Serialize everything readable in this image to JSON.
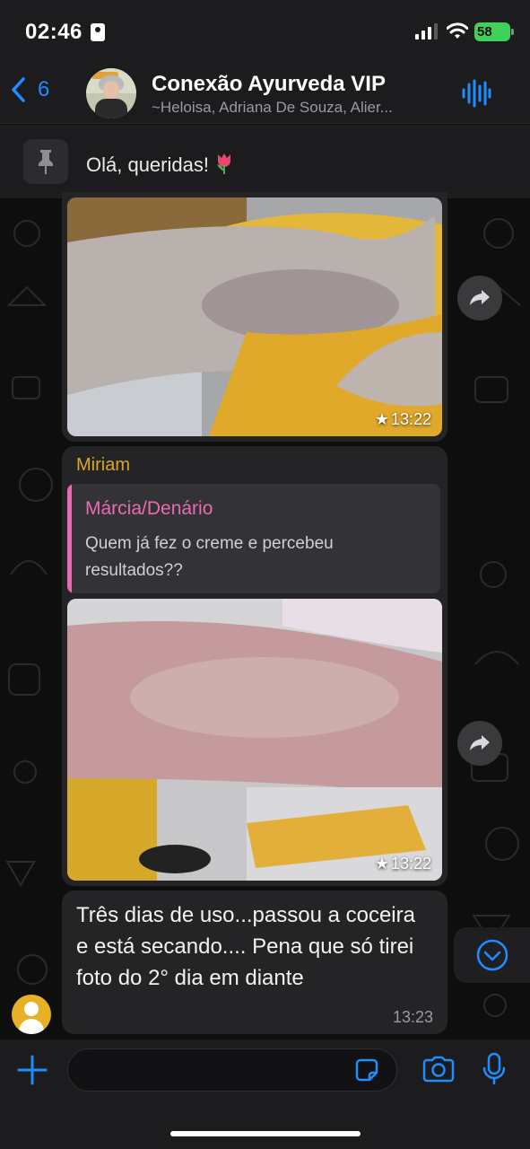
{
  "status_bar": {
    "time": "02:46",
    "battery": "58"
  },
  "header": {
    "back_count": "6",
    "group_name": "Conexão Ayurveda VIP",
    "members": "~Heloisa, Adriana De Souza, Alier..."
  },
  "pinned": {
    "text": "Olá, queridas!"
  },
  "messages": [
    {
      "type": "image",
      "time": "13:22",
      "starred": true
    },
    {
      "type": "image_reply",
      "sender": "Miriam",
      "quoted_author": "Márcia/Denário",
      "quoted_text": "Quem já  fez o creme e percebeu resultados??",
      "time": "13:22",
      "starred": true
    },
    {
      "type": "text",
      "text": "Três dias de uso...passou a coceira e está secando.... Pena que só tirei foto do 2° dia em diante",
      "time": "13:23"
    }
  ],
  "composer": {
    "placeholder": ""
  },
  "icons": {
    "back": "chevron-left-icon",
    "voice": "audio-waveform-icon",
    "pin": "pin-icon",
    "forward": "forward-icon",
    "scroll_down": "chevron-down-circle-icon",
    "plus": "plus-icon",
    "sticker": "sticker-icon",
    "camera": "camera-icon",
    "mic": "microphone-icon"
  },
  "colors": {
    "accent": "#1f8dff",
    "sender_name": "#d9a628",
    "quoted_author": "#e96bb3",
    "battery": "#3fd15a"
  }
}
